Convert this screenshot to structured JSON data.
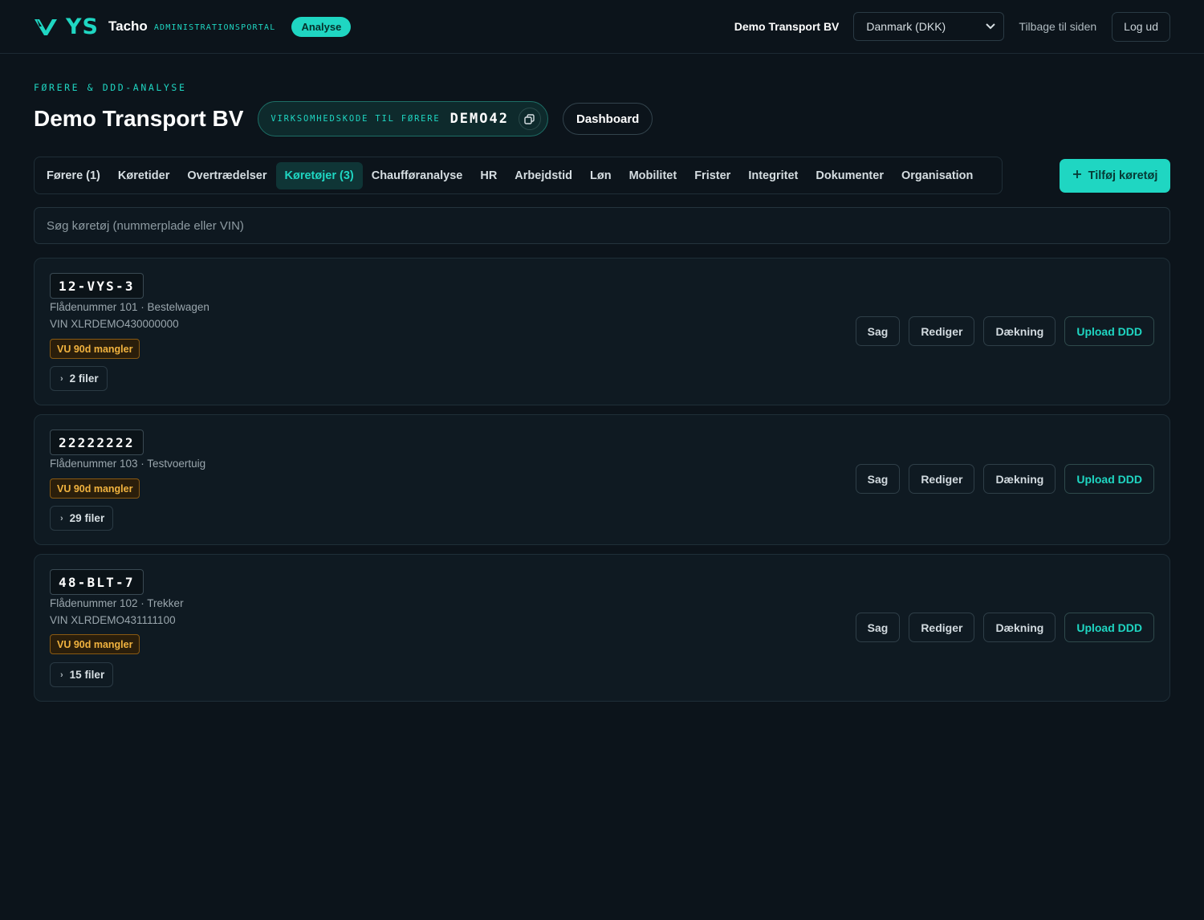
{
  "topbar": {
    "logo_text": "YS",
    "brand_name": "Tacho",
    "brand_sub": "ADMINISTRATIONSPORTAL",
    "analyse_badge": "Analyse",
    "company": "Demo Transport BV",
    "country_select": "Danmark (DKK)",
    "back_link": "Tilbage til siden",
    "logout": "Log ud"
  },
  "header": {
    "eyebrow": "FØRERE & DDD-ANALYSE",
    "title": "Demo Transport BV",
    "code_label": "VIRKSOMHEDSKODE TIL FØRERE",
    "code_value": "DEMO42",
    "dashboard": "Dashboard"
  },
  "tabs": [
    {
      "label": "Førere (1)",
      "active": false
    },
    {
      "label": "Køretider",
      "active": false
    },
    {
      "label": "Overtrædelser",
      "active": false
    },
    {
      "label": "Køretøjer (3)",
      "active": true
    },
    {
      "label": "Chaufføranalyse",
      "active": false
    },
    {
      "label": "HR",
      "active": false
    },
    {
      "label": "Arbejdstid",
      "active": false
    },
    {
      "label": "Løn",
      "active": false
    },
    {
      "label": "Mobilitet",
      "active": false
    },
    {
      "label": "Frister",
      "active": false
    },
    {
      "label": "Integritet",
      "active": false
    },
    {
      "label": "Dokumenter",
      "active": false
    },
    {
      "label": "Organisation",
      "active": false
    }
  ],
  "add_vehicle": "Tilføj køretøj",
  "search": {
    "placeholder": "Søg køretøj (nummerplade eller VIN)"
  },
  "vehicles": [
    {
      "plate": "12-VYS-3",
      "fleet": "Flådenummer 101 · Bestelwagen",
      "vin": "VIN XLRDEMO430000000",
      "warning": "VU 90d mangler",
      "files": "2 filer"
    },
    {
      "plate": "22222222",
      "fleet": "Flådenummer 103 · Testvoertuig",
      "vin": "",
      "warning": "VU 90d mangler",
      "files": "29 filer"
    },
    {
      "plate": "48-BLT-7",
      "fleet": "Flådenummer 102 · Trekker",
      "vin": "VIN XLRDEMO431111100",
      "warning": "VU 90d mangler",
      "files": "15 filer"
    }
  ],
  "vehicle_actions": {
    "case": "Sag",
    "edit": "Rediger",
    "coverage": "Dækning",
    "upload": "Upload DDD"
  },
  "colors": {
    "background": "#0c141b",
    "accent": "#1fd6c2",
    "warning": "#f1b33f"
  }
}
